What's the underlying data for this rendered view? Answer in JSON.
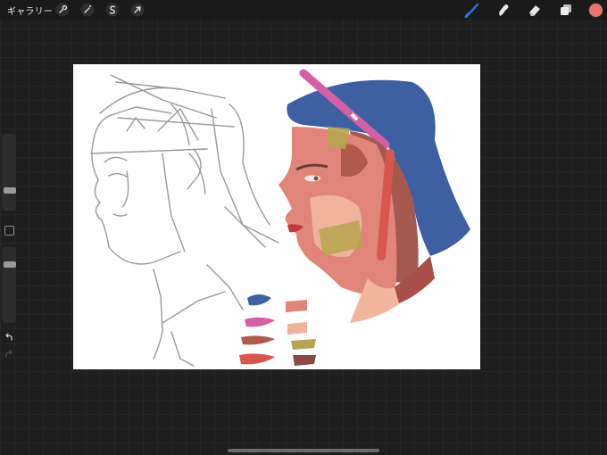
{
  "toolbar": {
    "gallery_label": "ギャラリー",
    "left_tools": [
      {
        "icon": "wrench-icon"
      },
      {
        "icon": "magic-wand-icon"
      },
      {
        "icon": "selection-icon"
      },
      {
        "icon": "transform-arrow-icon"
      }
    ],
    "right_tools": [
      {
        "icon": "brush-icon",
        "active": true
      },
      {
        "icon": "smudge-icon"
      },
      {
        "icon": "eraser-icon"
      },
      {
        "icon": "layers-icon"
      }
    ],
    "current_color": "#e87572"
  },
  "sidebar": {
    "brush_size_level": 0.5,
    "brush_opacity_level": 0.8
  },
  "colors": {
    "accent_brush": "#2f6fe0",
    "cap_blue": "#3f5fa3",
    "skin": "#e1857a",
    "skin_light": "#f0b29a",
    "shadow": "#b05a4e",
    "olive": "#b7a551",
    "pink": "#d55fa4"
  }
}
